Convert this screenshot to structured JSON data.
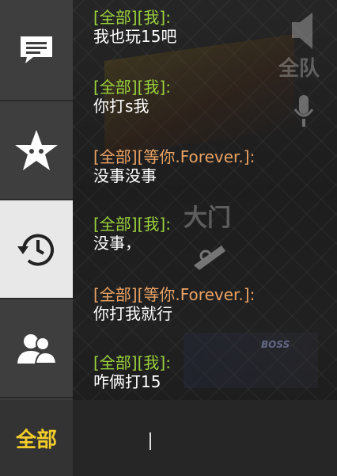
{
  "sidebar": {
    "chat_icon": "chat-bubble-icon",
    "favorites_icon": "star-face-icon",
    "history_icon": "history-clock-icon",
    "friends_icon": "friends-icon",
    "channel_label": "全部"
  },
  "game_scene": {
    "team_label": "全队",
    "gate_label": "大门",
    "boss_text": "BOSS"
  },
  "messages": [
    {
      "sender": "[全部][我]:",
      "text": "我也玩15吧",
      "type": "me"
    },
    {
      "sender": "[全部][我]:",
      "text": "你打s我",
      "type": "me"
    },
    {
      "sender": "[全部][等你.Forever.]:",
      "text": "没事没事",
      "type": "other"
    },
    {
      "sender": "[全部][我]:",
      "text": "没事，",
      "type": "me"
    },
    {
      "sender": "[全部][等你.Forever.]:",
      "text": "你打我就行",
      "type": "other"
    },
    {
      "sender": "[全部][我]:",
      "text": "咋俩打15",
      "type": "me"
    }
  ],
  "colors": {
    "my_name": "#9ad13c",
    "other_name": "#e9a264",
    "channel": "#f2cc2a",
    "active_tab": "#e8e8e8"
  },
  "input": {
    "value": ""
  }
}
